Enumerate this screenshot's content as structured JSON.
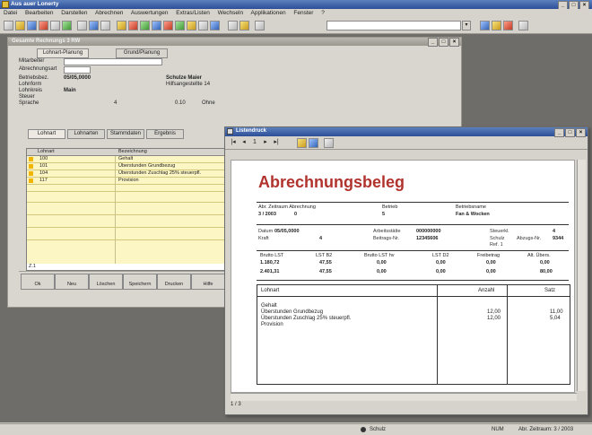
{
  "app": {
    "title": "Aus auer Lonerty",
    "controls": [
      "_",
      "□",
      "×"
    ]
  },
  "menu": [
    "Datei",
    "Bearbeiten",
    "Darstellen",
    "Abrechnen",
    "Auswertungen",
    "Extras/Listen",
    "Wechseln",
    "Applikationen",
    "Fenster",
    "?"
  ],
  "background_window": {
    "title": "Gesamte Rechnungs 3 RW",
    "fields": {
      "label_a": "Mitarbeiter",
      "label_b": "Abrechnungsart",
      "row2_label": "Betriebsbez.",
      "row2_value": "05/05,0000",
      "row2_name": "Schulze Maier",
      "row3_label": "Lohnform",
      "row3_value": "Hilfsangestellte 14",
      "row4_label": "Lohnkreis",
      "row4_value": "Main",
      "row5_label": "Steuer",
      "row6_label": "Sprache",
      "row6_num": "4",
      "row6_num2": "0.10",
      "row6_status": "Ohne"
    },
    "tabs_top": [
      "Lohnart-Planung",
      "Grund/Planung"
    ],
    "tabs": [
      "Lohnart",
      "Lohnarten",
      "Stammdaten",
      "Ergebnis"
    ],
    "grid": {
      "headers": [
        "Lohnart",
        "Bezeichnung"
      ],
      "rows": [
        {
          "code": "100",
          "text": "Gehalt"
        },
        {
          "code": "101",
          "text": "Überstunden Grundbezug"
        },
        {
          "code": "104",
          "text": "Überstunden Zuschlag 25% steuerpfl."
        },
        {
          "code": "117",
          "text": "Provision"
        }
      ],
      "footer": "Z.1"
    },
    "buttons": [
      "Ok",
      "Neu",
      "Löschen",
      "Speichern",
      "Drucken",
      "Hilfe"
    ]
  },
  "report_window": {
    "title": "Listendruck",
    "toolbar_page": "1",
    "heading": "Abrechnungsbeleg",
    "info": {
      "h1": "Abr. Zeitraum  Abrechnung",
      "v1": "3 / 2003",
      "v1b": "0",
      "h2": "Betrieb",
      "v2": "5",
      "h3": "Betriebsname",
      "v3": "Fan & Wocken"
    },
    "personal": {
      "l1": "Datum",
      "v1": "05/05,0000",
      "l2": "Arbeitsstätte",
      "v2": "000000000",
      "l3": "Kraft",
      "v3": "4",
      "l4": "Beitrags-Nr.",
      "v4": "12345606",
      "l5": "Steuerkl.",
      "v5": "4",
      "l6": "Abzugs-Nr.",
      "v6": "9344",
      "name": "Schulz",
      "name_code": "Ref. 1"
    },
    "tax_grid": {
      "headers": [
        "Brutto LST",
        "LST B2",
        "Brutto LST hv",
        "LST D2",
        "Freibetrag",
        "Alt. Übers."
      ],
      "values1": [
        "1.180,72",
        "47,55",
        "0,00",
        "0,00",
        "0,00",
        "0,00"
      ],
      "values2": [
        "2.401,31",
        "47,55",
        "0,00",
        "0,00",
        "0,00",
        "80,00"
      ]
    },
    "table": {
      "headers": [
        "Lohnart",
        "Anzahl",
        "Satz"
      ],
      "rows": [
        {
          "text": "Gehalt",
          "anzahl": "",
          "satz": ""
        },
        {
          "text": "Überstunden Grundbezug",
          "anzahl": "12,00",
          "satz": "11,00"
        },
        {
          "text": "Überstunden Zuschlag 25% steuerpfl.",
          "anzahl": "12,00",
          "satz": "5,04"
        },
        {
          "text": "Provision",
          "anzahl": "",
          "satz": ""
        }
      ]
    },
    "page_status": "1 / 3"
  },
  "statusbar": {
    "user": "Schulz",
    "mode": "NUM",
    "info": "Abr. Zeitraum: 3 / 2003"
  }
}
